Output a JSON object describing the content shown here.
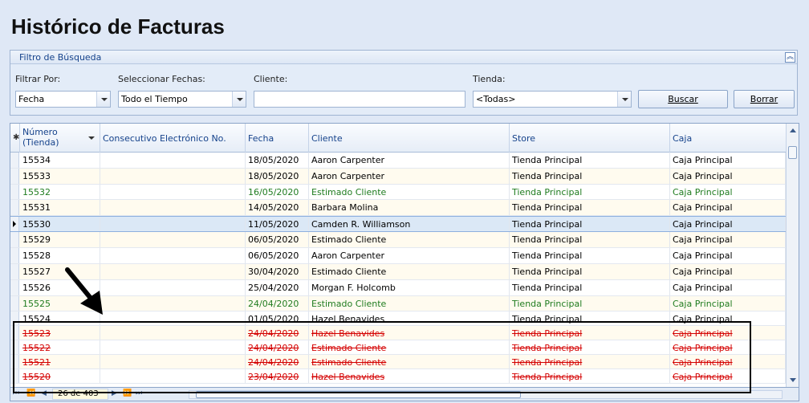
{
  "page": {
    "title": "Histórico de Facturas"
  },
  "filter": {
    "panel_title": "Filtro de Búsqueda",
    "collapse_icon": "double-chevron-up-icon",
    "filtrar_por_label": "Filtrar Por:",
    "filtrar_por_value": "Fecha",
    "fechas_label": "Seleccionar Fechas:",
    "fechas_value": "Todo el Tiempo",
    "cliente_label": "Cliente:",
    "cliente_value": "",
    "tienda_label": "Tienda:",
    "tienda_value": "<Todas>",
    "buscar_label": "Buscar",
    "borrar_label": "Borrar"
  },
  "grid": {
    "columns": {
      "numero": "Número (Tienda)",
      "consecutivo": "Consecutivo Electrónico No.",
      "fecha": "Fecha",
      "cliente": "Cliente",
      "store": "Store",
      "caja": "Caja"
    },
    "rows": [
      {
        "numero": "15534",
        "consecutivo": "",
        "fecha": "18/05/2020",
        "cliente": "Aaron Carpenter",
        "store": "Tienda Principal",
        "caja": "Caja Principal",
        "status": "normal"
      },
      {
        "numero": "15533",
        "consecutivo": "",
        "fecha": "18/05/2020",
        "cliente": "Aaron Carpenter",
        "store": "Tienda Principal",
        "caja": "Caja Principal",
        "status": "normal"
      },
      {
        "numero": "15532",
        "consecutivo": "",
        "fecha": "16/05/2020",
        "cliente": "Estimado Cliente",
        "store": "Tienda Principal",
        "caja": "Caja Principal",
        "status": "green"
      },
      {
        "numero": "15531",
        "consecutivo": "",
        "fecha": "14/05/2020",
        "cliente": "Barbara Molina",
        "store": "Tienda Principal",
        "caja": "Caja Principal",
        "status": "normal"
      },
      {
        "numero": "15530",
        "consecutivo": "",
        "fecha": "11/05/2020",
        "cliente": "Camden R. Williamson",
        "store": "Tienda Principal",
        "caja": "Caja Principal",
        "status": "selected"
      },
      {
        "numero": "15529",
        "consecutivo": "",
        "fecha": "06/05/2020",
        "cliente": "Estimado Cliente",
        "store": "Tienda Principal",
        "caja": "Caja Principal",
        "status": "normal"
      },
      {
        "numero": "15528",
        "consecutivo": "",
        "fecha": "06/05/2020",
        "cliente": "Aaron Carpenter",
        "store": "Tienda Principal",
        "caja": "Caja Principal",
        "status": "normal"
      },
      {
        "numero": "15527",
        "consecutivo": "",
        "fecha": "30/04/2020",
        "cliente": "Estimado Cliente",
        "store": "Tienda Principal",
        "caja": "Caja Principal",
        "status": "normal"
      },
      {
        "numero": "15526",
        "consecutivo": "",
        "fecha": "25/04/2020",
        "cliente": "Morgan F. Holcomb",
        "store": "Tienda Principal",
        "caja": "Caja Principal",
        "status": "normal"
      },
      {
        "numero": "15525",
        "consecutivo": "",
        "fecha": "24/04/2020",
        "cliente": "Estimado Cliente",
        "store": "Tienda Principal",
        "caja": "Caja Principal",
        "status": "green"
      },
      {
        "numero": "15524",
        "consecutivo": "",
        "fecha": "01/05/2020",
        "cliente": "Hazel Benavides",
        "store": "Tienda Principal",
        "caja": "Caja Principal",
        "status": "normal"
      },
      {
        "numero": "15523",
        "consecutivo": "",
        "fecha": "24/04/2020",
        "cliente": "Hazel Benavides",
        "store": "Tienda Principal",
        "caja": "Caja Principal",
        "status": "red"
      },
      {
        "numero": "15522",
        "consecutivo": "",
        "fecha": "24/04/2020",
        "cliente": "Estimado Cliente",
        "store": "Tienda Principal",
        "caja": "Caja Principal",
        "status": "red"
      },
      {
        "numero": "15521",
        "consecutivo": "",
        "fecha": "24/04/2020",
        "cliente": "Estimado Cliente",
        "store": "Tienda Principal",
        "caja": "Caja Principal",
        "status": "red"
      },
      {
        "numero": "15520",
        "consecutivo": "",
        "fecha": "23/04/2020",
        "cliente": "Hazel Benavides",
        "store": "Tienda Principal",
        "caja": "Caja Principal",
        "status": "red"
      }
    ]
  },
  "navigator": {
    "position": "26 de 403",
    "icons": [
      "first-page-icon",
      "prev-page-icon",
      "prev-record-icon",
      "next-record-icon",
      "next-page-icon",
      "last-page-icon"
    ]
  },
  "colors": {
    "deleted": "#d40000",
    "pending": "#1f7c1f",
    "selected": "#dbe8f6"
  }
}
